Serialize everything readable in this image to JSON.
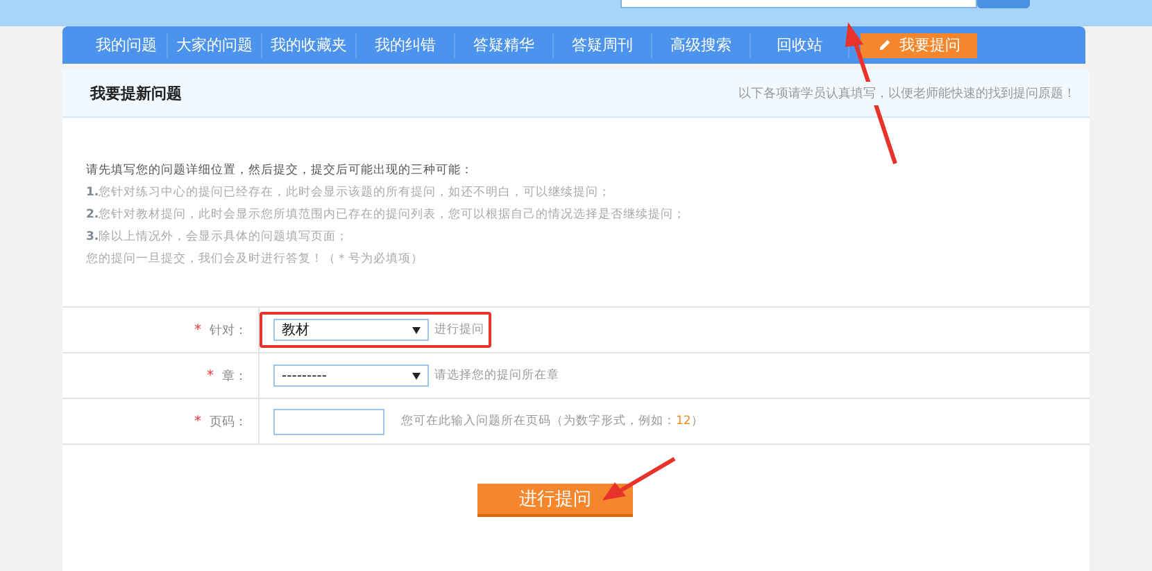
{
  "nav": [
    {
      "label": "我的问题",
      "selected": false
    },
    {
      "label": "大家的问题",
      "selected": false
    },
    {
      "label": "我的收藏夹",
      "selected": false
    },
    {
      "label": "我的纠错",
      "selected": false
    },
    {
      "label": "答疑精华",
      "selected": false
    },
    {
      "label": "答疑周刊",
      "selected": false
    },
    {
      "label": "高级搜索",
      "selected": false
    },
    {
      "label": "回收站",
      "selected": false
    },
    {
      "label": "我要提问",
      "selected": true
    }
  ],
  "panel": {
    "title": "我要提新问题",
    "note": "以下各项请学员认真填写，以便老师能快速的找到提问原题！"
  },
  "intro": {
    "lead": "请先填写您的问题详细位置，然后提交，提交后可能出现的三种可能：",
    "items": [
      {
        "number": "1.",
        "text": "您针对练习中心的提问已经存在，此时会显示该题的所有提问，如还不明白，可以继续提问；"
      },
      {
        "number": "2.",
        "text": "您针对教材提问，此时会显示您所填范围内已存在的提问列表，您可以根据自己的情况选择是否继续提问；"
      },
      {
        "number": "3.",
        "text": "除以上情况外，会显示具体的问题填写页面；"
      }
    ],
    "footer": "您的提问一旦提交，我们会及时进行答复！（＊号为必填项）"
  },
  "form": [
    {
      "kind": "select",
      "mark": "*",
      "label": "针对：",
      "value": "教材",
      "hint": "进行提问",
      "highlighted": true
    },
    {
      "kind": "select",
      "mark": "*",
      "label": "章：",
      "value": "---------",
      "hint": "请选择您的提问所在章",
      "highlighted": false
    },
    {
      "kind": "input",
      "mark": "*",
      "label": "页码：",
      "hint": "您可在此输入问题所在页码（为数字形式，例如：",
      "example": "12",
      "hint_end": "）",
      "highlighted": false
    }
  ],
  "submit": "进行提问"
}
